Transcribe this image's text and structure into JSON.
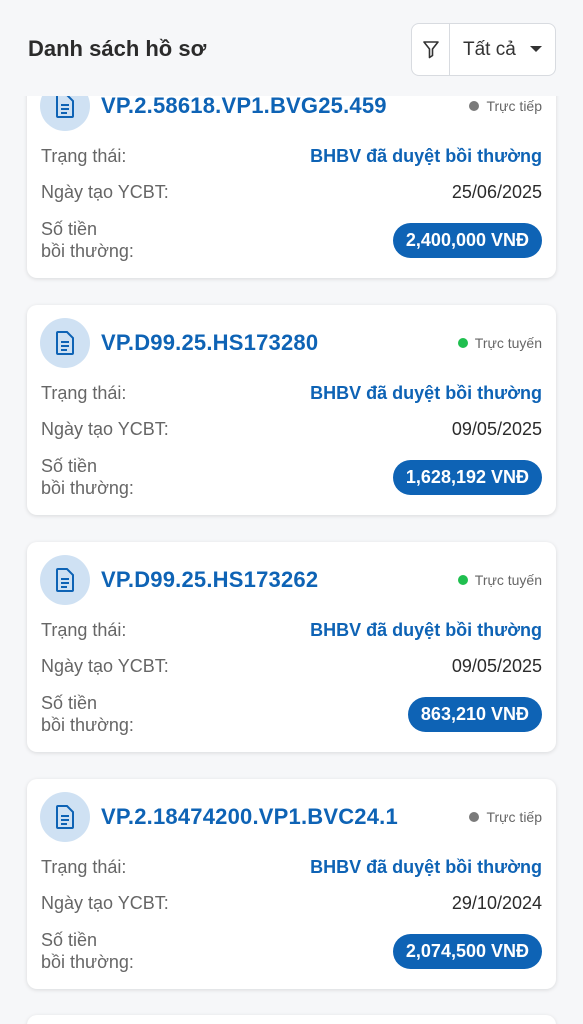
{
  "header": {
    "title": "Danh sách hồ sơ",
    "filter": {
      "icon": "funnel-icon",
      "value": "Tất cả",
      "caret_icon": "caret-down-icon"
    }
  },
  "claims": [
    {
      "code": "VP.2.58618.VP1.BVG25.459",
      "channel": "Trực tiếp",
      "channel_color": "#7a7a7a",
      "status_label": "Trạng thái:",
      "status_value": "BHBV đã duyệt bồi thường",
      "date_label": "Ngày tạo YCBT:",
      "date_value": "25/06/2025",
      "amount_label_1": "Số tiền",
      "amount_label_2": "bồi thường:",
      "amount_value": "2,400,000 VNĐ"
    },
    {
      "code": "VP.D99.25.HS173280",
      "channel": "Trực tuyến",
      "channel_color": "#1fbf4f",
      "status_label": "Trạng thái:",
      "status_value": "BHBV đã duyệt bồi thường",
      "date_label": "Ngày tạo YCBT:",
      "date_value": "09/05/2025",
      "amount_label_1": "Số tiền",
      "amount_label_2": "bồi thường:",
      "amount_value": "1,628,192 VNĐ"
    },
    {
      "code": "VP.D99.25.HS173262",
      "channel": "Trực tuyến",
      "channel_color": "#1fbf4f",
      "status_label": "Trạng thái:",
      "status_value": "BHBV đã duyệt bồi thường",
      "date_label": "Ngày tạo YCBT:",
      "date_value": "09/05/2025",
      "amount_label_1": "Số tiền",
      "amount_label_2": "bồi thường:",
      "amount_value": "863,210 VNĐ"
    },
    {
      "code": "VP.2.18474200.VP1.BVC24.1",
      "channel": "Trực tiếp",
      "channel_color": "#7a7a7a",
      "status_label": "Trạng thái:",
      "status_value": "BHBV đã duyệt bồi thường",
      "date_label": "Ngày tạo YCBT:",
      "date_value": "29/10/2024",
      "amount_label_1": "Số tiền",
      "amount_label_2": "bồi thường:",
      "amount_value": "2,074,500 VNĐ"
    }
  ],
  "colors": {
    "accent": "#0e63b5",
    "badge_bg": "#cfe1f3"
  }
}
